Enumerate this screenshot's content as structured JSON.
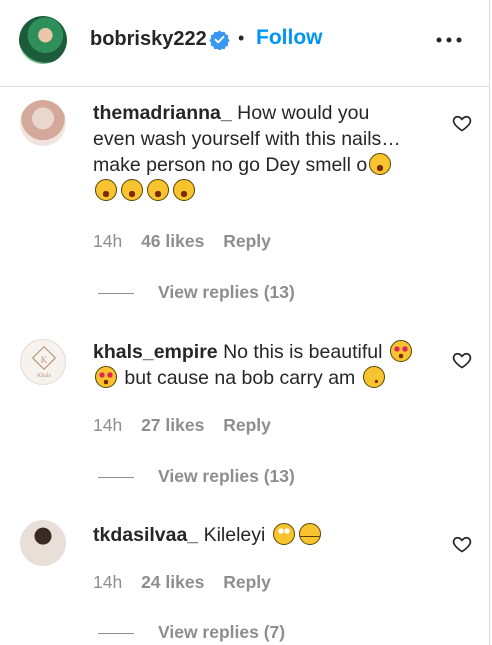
{
  "header": {
    "username": "bobrisky222",
    "separator": "•",
    "follow_label": "Follow",
    "more_icon": "more-horizontal-icon"
  },
  "comments": [
    {
      "username": "themadrianna_",
      "text_line1": "How would you",
      "text_line2": "even wash yourself with this nails…",
      "text_line3": "make person no go Dey smell o",
      "time": "14h",
      "likes": "46 likes",
      "reply": "Reply",
      "view_replies": "View replies (13)"
    },
    {
      "username": "khals_empire",
      "text_line1": "No this is beautiful",
      "text_line2": "but cause na bob carry am",
      "time": "14h",
      "likes": "27 likes",
      "reply": "Reply",
      "view_replies": "View replies (13)"
    },
    {
      "username": "tkdasilvaa_",
      "text_line1": "Kileleyi",
      "time": "14h",
      "likes": "24 likes",
      "reply": "Reply",
      "view_replies": "View replies (7)"
    }
  ],
  "colors": {
    "link": "#0095f6",
    "secondary_text": "#8e8e8e",
    "primary_text": "#262626",
    "border": "#dbdbdb"
  }
}
